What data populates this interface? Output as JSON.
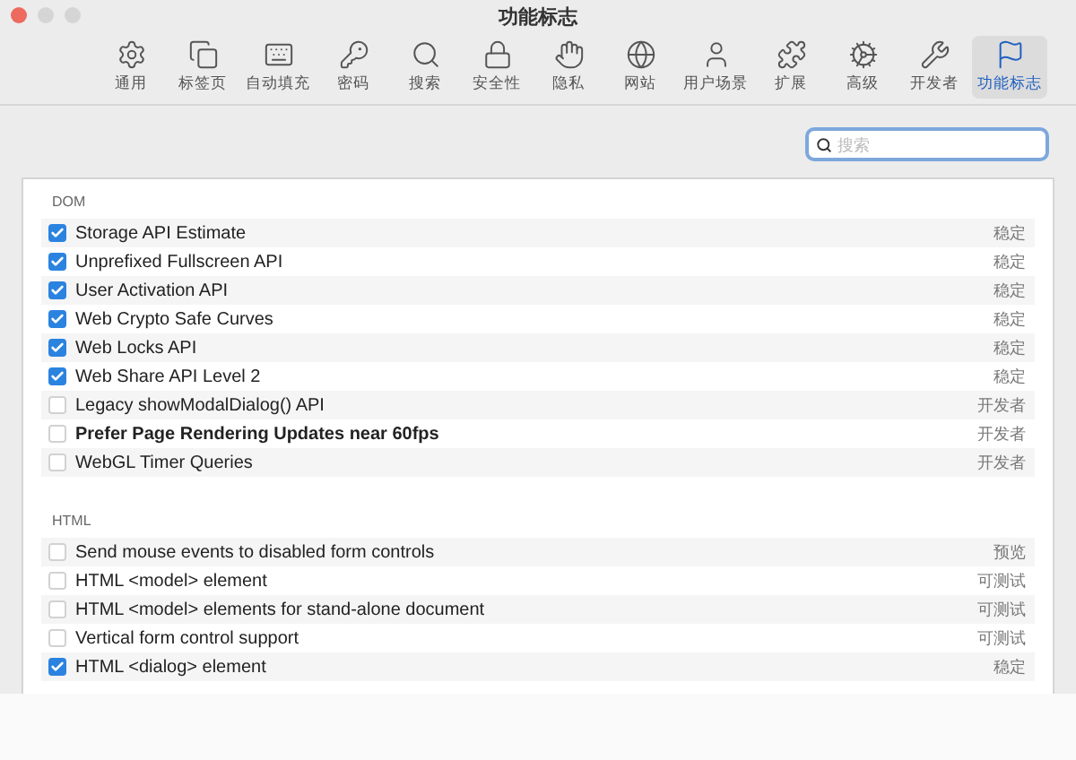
{
  "window": {
    "title": "功能标志"
  },
  "toolbar": [
    {
      "kind": "general",
      "label": "通用",
      "selected": false
    },
    {
      "kind": "tabs",
      "label": "标签页",
      "selected": false
    },
    {
      "kind": "autofill",
      "label": "自动填充",
      "selected": false
    },
    {
      "kind": "passwords",
      "label": "密码",
      "selected": false
    },
    {
      "kind": "search",
      "label": "搜索",
      "selected": false
    },
    {
      "kind": "security",
      "label": "安全性",
      "selected": false
    },
    {
      "kind": "privacy",
      "label": "隐私",
      "selected": false
    },
    {
      "kind": "websites",
      "label": "网站",
      "selected": false
    },
    {
      "kind": "profiles",
      "label": "用户场景",
      "selected": false
    },
    {
      "kind": "extensions",
      "label": "扩展",
      "selected": false
    },
    {
      "kind": "advanced",
      "label": "高级",
      "selected": false
    },
    {
      "kind": "developer",
      "label": "开发者",
      "selected": false
    },
    {
      "kind": "flags",
      "label": "功能标志",
      "selected": true
    }
  ],
  "search": {
    "placeholder": "搜索"
  },
  "sections": [
    {
      "title": "DOM",
      "rows": [
        {
          "label": "Storage API Estimate",
          "checked": true,
          "emphasized": false,
          "status": "稳定"
        },
        {
          "label": "Unprefixed Fullscreen API",
          "checked": true,
          "emphasized": false,
          "status": "稳定"
        },
        {
          "label": "User Activation API",
          "checked": true,
          "emphasized": false,
          "status": "稳定"
        },
        {
          "label": "Web Crypto Safe Curves",
          "checked": true,
          "emphasized": false,
          "status": "稳定"
        },
        {
          "label": "Web Locks API",
          "checked": true,
          "emphasized": false,
          "status": "稳定"
        },
        {
          "label": "Web Share API Level 2",
          "checked": true,
          "emphasized": false,
          "status": "稳定"
        },
        {
          "label": "Legacy showModalDialog() API",
          "checked": false,
          "emphasized": false,
          "status": "开发者"
        },
        {
          "label": "Prefer Page Rendering Updates near 60fps",
          "checked": false,
          "emphasized": true,
          "status": "开发者"
        },
        {
          "label": "WebGL Timer Queries",
          "checked": false,
          "emphasized": false,
          "status": "开发者"
        }
      ]
    },
    {
      "title": "HTML",
      "rows": [
        {
          "label": "Send mouse events to disabled form controls",
          "checked": false,
          "emphasized": false,
          "status": "预览"
        },
        {
          "label": "HTML <model> element",
          "checked": false,
          "emphasized": false,
          "status": "可测试"
        },
        {
          "label": "HTML <model> elements for stand-alone document",
          "checked": false,
          "emphasized": false,
          "status": "可测试"
        },
        {
          "label": "Vertical form control support",
          "checked": false,
          "emphasized": false,
          "status": "可测试"
        },
        {
          "label": "HTML <dialog> element",
          "checked": true,
          "emphasized": false,
          "status": "稳定"
        }
      ]
    }
  ]
}
